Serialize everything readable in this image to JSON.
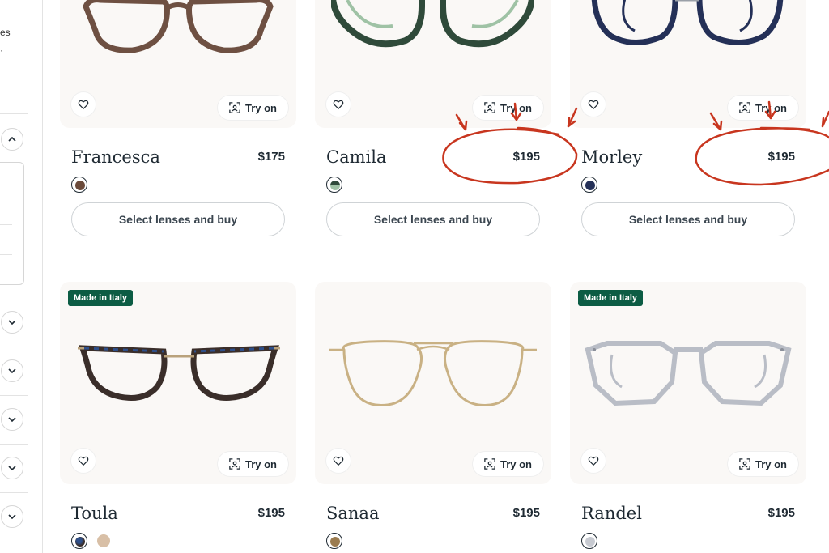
{
  "sidebar": {
    "text_1": "es",
    "text_2": "·"
  },
  "try_on_label": "Try on",
  "buy_label": "Select lenses and buy",
  "badge_label": "Made in Italy",
  "products": [
    {
      "name": "Francesca",
      "price": "$175",
      "colors": [
        "#6b4a3a"
      ],
      "frame": "brown"
    },
    {
      "name": "Camila",
      "price": "$195",
      "colors": [
        "#2f4a3a"
      ],
      "frame": "green"
    },
    {
      "name": "Morley",
      "price": "$195",
      "colors": [
        "#243057"
      ],
      "frame": "navy"
    },
    {
      "name": "Toula",
      "price": "$195",
      "colors": [
        "#3a2e2a",
        "#d8bfa6"
      ],
      "frame": "tortoise",
      "badge": true
    },
    {
      "name": "Sanaa",
      "price": "$195",
      "colors": [
        "#9a7b4f"
      ],
      "frame": "gold"
    },
    {
      "name": "Randel",
      "price": "$195",
      "colors": [
        "#c7cad1"
      ],
      "frame": "crystal",
      "badge": true
    }
  ],
  "annotation_color": "#c8361f"
}
